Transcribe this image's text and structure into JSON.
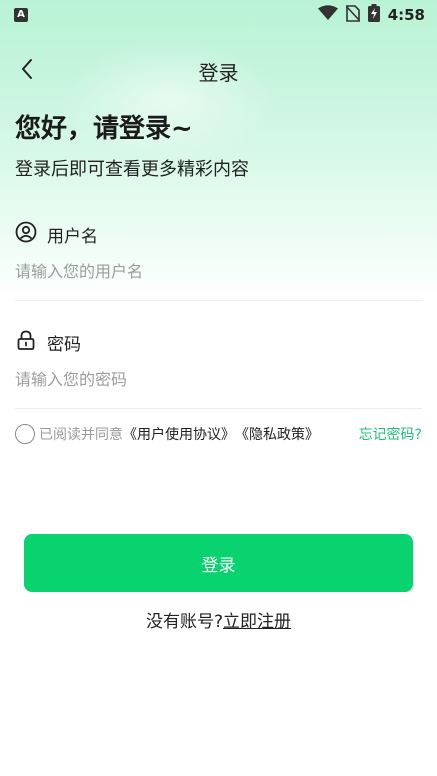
{
  "status_bar": {
    "left_badge": "A",
    "time": "4:58",
    "icons": [
      "wifi-icon",
      "no-sim-icon",
      "battery-charging-icon"
    ]
  },
  "header": {
    "title": "登录",
    "back_icon": "chevron-left-icon"
  },
  "greeting": {
    "title": "您好，请登录~",
    "subtitle": "登录后即可查看更多精彩内容"
  },
  "username": {
    "label": "用户名",
    "icon": "user-circle-icon",
    "placeholder": "请输入您的用户名",
    "value": ""
  },
  "password": {
    "label": "密码",
    "icon": "lock-icon",
    "placeholder": "请输入您的密码",
    "value": ""
  },
  "agreement": {
    "prefix": "已阅读并同意",
    "user_agreement": "《用户使用协议》",
    "privacy_policy": "《隐私政策》",
    "checked": false
  },
  "forgot_password": "忘记密码?",
  "login_button": "登录",
  "register": {
    "prompt": "没有账号?",
    "link": "立即注册"
  },
  "colors": {
    "accent": "#08d36f",
    "link_green": "#21c07a",
    "background_top": "#b9f3d6"
  }
}
